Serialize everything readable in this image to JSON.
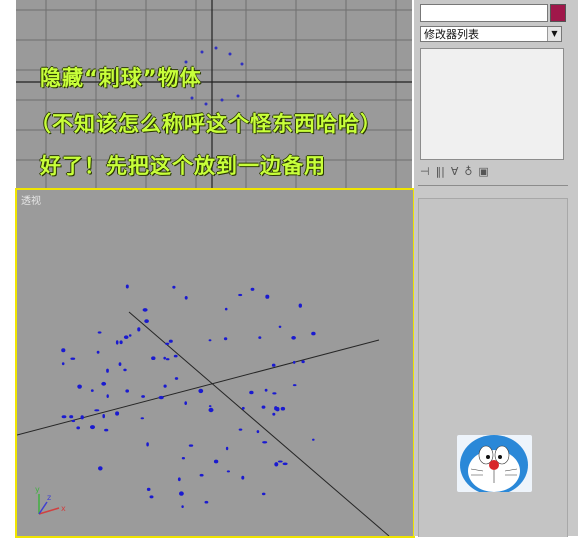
{
  "overlay": {
    "line1": "隐藏“刺球”物体",
    "line2": "（不知该怎么称呼这个怪东西哈哈）",
    "line3": "好了！先把这个放到一边备用"
  },
  "viewport_perspective": {
    "label": "透视"
  },
  "command_panel": {
    "name_field": "",
    "modifier_list": "修改器列表",
    "object_color": "#a0174a"
  },
  "axes": {
    "x": "x",
    "y": "y",
    "z": "z"
  },
  "colors": {
    "viewport_bg": "#9b9b9b",
    "grid": "#3a3a3a",
    "active_border": "#f0e500",
    "caption": "#c8ff3a",
    "dots": "#1a1ad0"
  },
  "icons": [
    "pin-stack-icon",
    "show-end-result-icon",
    "make-unique-icon",
    "remove-modifier-icon",
    "configure-modifier-sets-icon"
  ]
}
